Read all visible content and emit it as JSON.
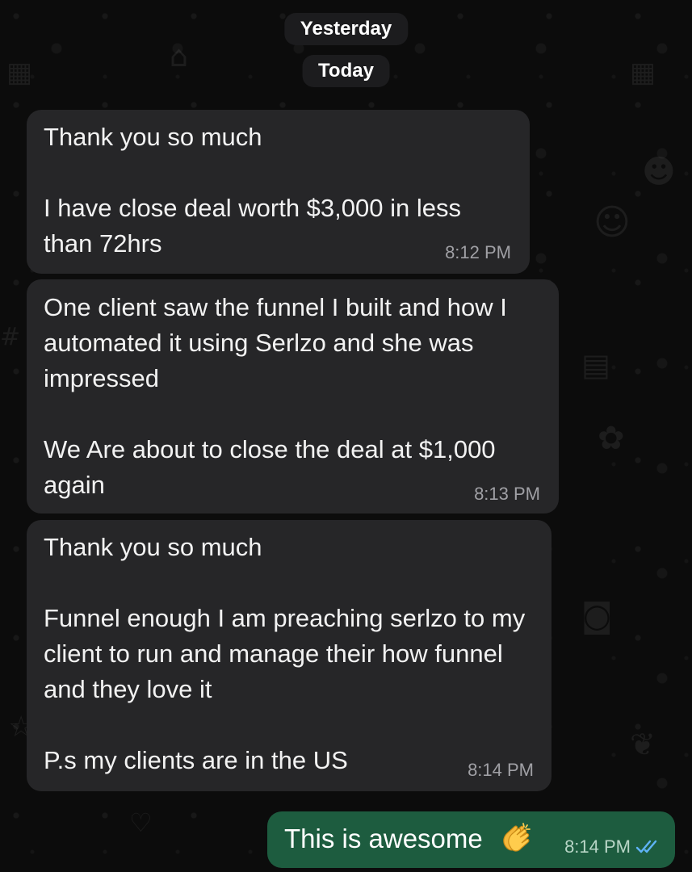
{
  "date_separators": {
    "yesterday": "Yesterday",
    "today": "Today"
  },
  "messages": [
    {
      "direction": "incoming",
      "text": "Thank you so much\n\nI have close deal worth $3,000 in less than 72hrs",
      "time": "8:12 PM"
    },
    {
      "direction": "incoming",
      "text": "One client saw the funnel I built and how I automated it using Serlzo and she was impressed\n\nWe Are about to close the deal at $1,000 again",
      "time": "8:13 PM"
    },
    {
      "direction": "incoming",
      "text": "Thank you so much\n\nFunnel enough I am preaching serlzo to my client to run and manage their how funnel and they love it\n\nP.s my clients are in the US",
      "time": "8:14 PM"
    },
    {
      "direction": "outgoing",
      "text": "This is awesome",
      "emoji": "clapping-hands",
      "time": "8:14 PM",
      "status": "read-double-check"
    }
  ],
  "colors": {
    "incoming_bubble": "#262628",
    "outgoing_bubble": "#1d5c3f",
    "read_check": "#5fb3f6"
  }
}
